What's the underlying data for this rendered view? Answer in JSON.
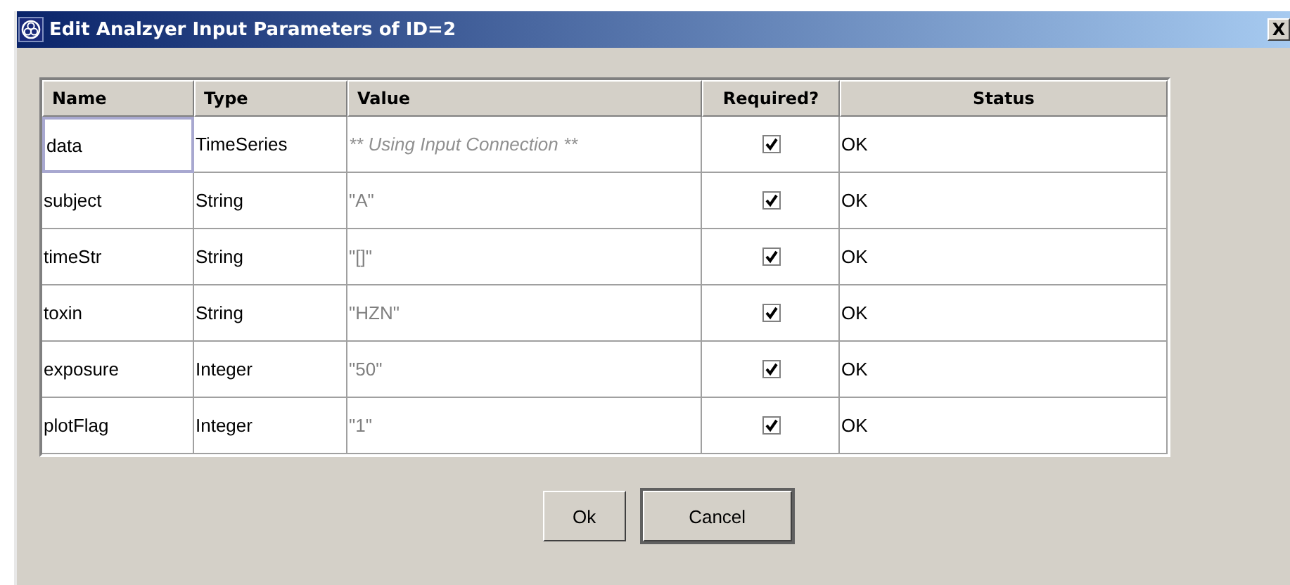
{
  "window": {
    "title": "Edit Analzyer Input Parameters of ID=2",
    "close": "X"
  },
  "table": {
    "columns": [
      "Name",
      "Type",
      "Value",
      "Required?",
      "Status"
    ],
    "rows": [
      {
        "name": "data",
        "type": "TimeSeries",
        "value": {
          "kind": "connection",
          "text": "** Using Input Connection **"
        },
        "required": true,
        "status": "OK",
        "focused": true
      },
      {
        "name": "subject",
        "type": "String",
        "value": {
          "kind": "literal",
          "text": "\"A\""
        },
        "required": true,
        "status": "OK",
        "focused": false
      },
      {
        "name": "timeStr",
        "type": "String",
        "value": {
          "kind": "literal",
          "text": "\"[]\""
        },
        "required": true,
        "status": "OK",
        "focused": false
      },
      {
        "name": "toxin",
        "type": "String",
        "value": {
          "kind": "literal",
          "text": "\"HZN\""
        },
        "required": true,
        "status": "OK",
        "focused": false
      },
      {
        "name": "exposure",
        "type": "Integer",
        "value": {
          "kind": "literal",
          "text": "\"50\""
        },
        "required": true,
        "status": "OK",
        "focused": false
      },
      {
        "name": "plotFlag",
        "type": "Integer",
        "value": {
          "kind": "literal",
          "text": "\"1\""
        },
        "required": true,
        "status": "OK",
        "focused": false
      }
    ]
  },
  "buttons": [
    {
      "label": "Ok",
      "default": false
    },
    {
      "label": "Cancel",
      "default": true
    }
  ]
}
